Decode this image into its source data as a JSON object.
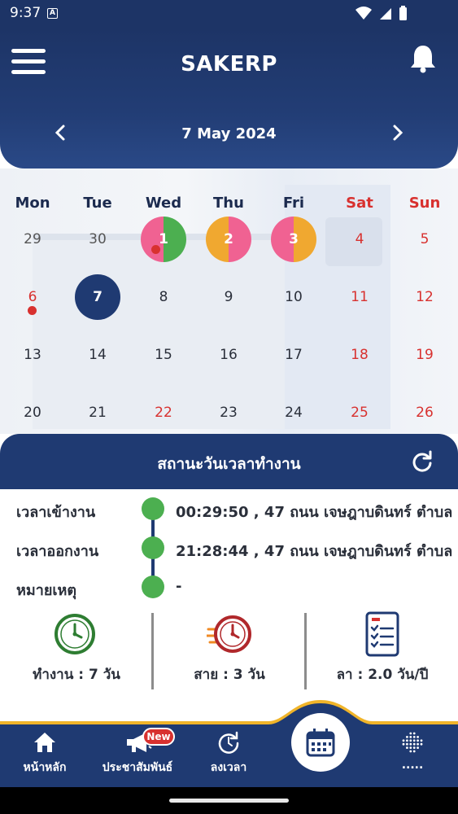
{
  "status_bar": {
    "time": "9:37",
    "notif_glyph": "A"
  },
  "header": {
    "app_title": "SAKERP",
    "date_label": "7 May 2024",
    "icons": [
      "menu-icon",
      "bell-icon",
      "chevron-left-icon",
      "chevron-right-icon"
    ]
  },
  "calendar": {
    "day_names": [
      "Mon",
      "Tue",
      "Wed",
      "Thu",
      "Fri",
      "Sat",
      "Sun"
    ],
    "weeks": [
      [
        "29",
        "30",
        "1",
        "2",
        "3",
        "4",
        "5"
      ],
      [
        "6",
        "7",
        "8",
        "9",
        "10",
        "11",
        "12"
      ],
      [
        "13",
        "14",
        "15",
        "16",
        "17",
        "18",
        "19"
      ],
      [
        "20",
        "21",
        "22",
        "23",
        "24",
        "25",
        "26"
      ]
    ],
    "colors": {
      "pink": "#f06292",
      "green": "#4caf50",
      "orange": "#f0a830",
      "selected": "#1f3a72",
      "red": "#d8312f"
    }
  },
  "status_panel": {
    "title": "สถานะวันเวลาทำงาน",
    "rows": [
      {
        "label": "เวลาเข้างาน",
        "value": "00:29:50 , 47 ถนน เจษฎาบดินทร์ ตำบล"
      },
      {
        "label": "เวลาออกงาน",
        "value": "21:28:44 , 47 ถนน เจษฎาบดินทร์ ตำบล"
      },
      {
        "label": "หมายเหตุ",
        "value": "-"
      }
    ],
    "stats": [
      {
        "label": "ทำงาน : 7 วัน",
        "icon": "clock-icon"
      },
      {
        "label": "สาย : 3 วัน",
        "icon": "late-clock-icon"
      },
      {
        "label": "ลา : 2.0 วัน/ปี",
        "icon": "leave-checklist-icon"
      }
    ]
  },
  "bottom_nav": {
    "items": [
      {
        "label": "หน้าหลัก",
        "icon": "home-icon"
      },
      {
        "label": "ประชาสัมพันธ์",
        "icon": "megaphone-icon"
      },
      {
        "label": "ลงเวลา",
        "icon": "time-refresh-icon"
      },
      {
        "label": ".....",
        "icon": "dots-grid-icon"
      }
    ],
    "badge": "New",
    "center_icon": "calendar-icon"
  }
}
